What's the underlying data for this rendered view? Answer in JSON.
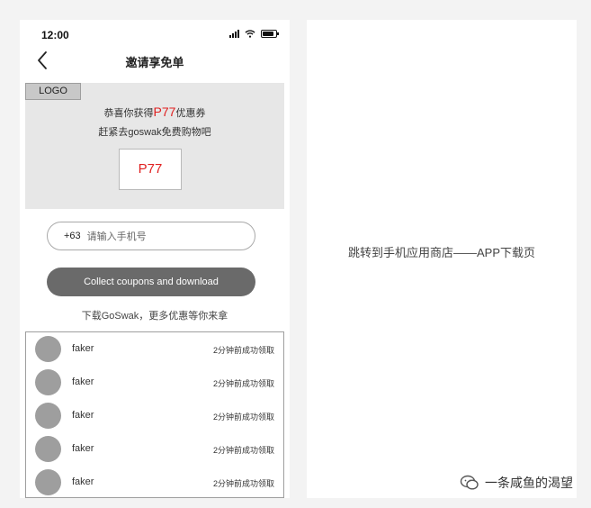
{
  "status_bar": {
    "time": "12:00"
  },
  "header": {
    "title": "邀请享免单"
  },
  "banner": {
    "logo": "LOGO",
    "line1_before": "恭喜你获得",
    "line1_highlight": "P77",
    "line1_after": "优惠券",
    "line2": "赶紧去goswak免费购物吧",
    "coupon_code": "P77",
    "highlight_color": "#e02020"
  },
  "phone_input": {
    "prefix": "+63",
    "placeholder": "请输入手机号"
  },
  "cta": {
    "label": "Collect coupons and download"
  },
  "hint": "下载GoSwak，更多优惠等你来拿",
  "claims": [
    {
      "name": "faker",
      "time": "2分钟前成功领取"
    },
    {
      "name": "faker",
      "time": "2分钟前成功领取"
    },
    {
      "name": "faker",
      "time": "2分钟前成功领取"
    },
    {
      "name": "faker",
      "time": "2分钟前成功领取"
    },
    {
      "name": "faker",
      "time": "2分钟前成功领取"
    }
  ],
  "right_panel": {
    "text": "跳转到手机应用商店——APP下载页"
  },
  "watermark": {
    "text": "一条咸鱼的渴望"
  }
}
